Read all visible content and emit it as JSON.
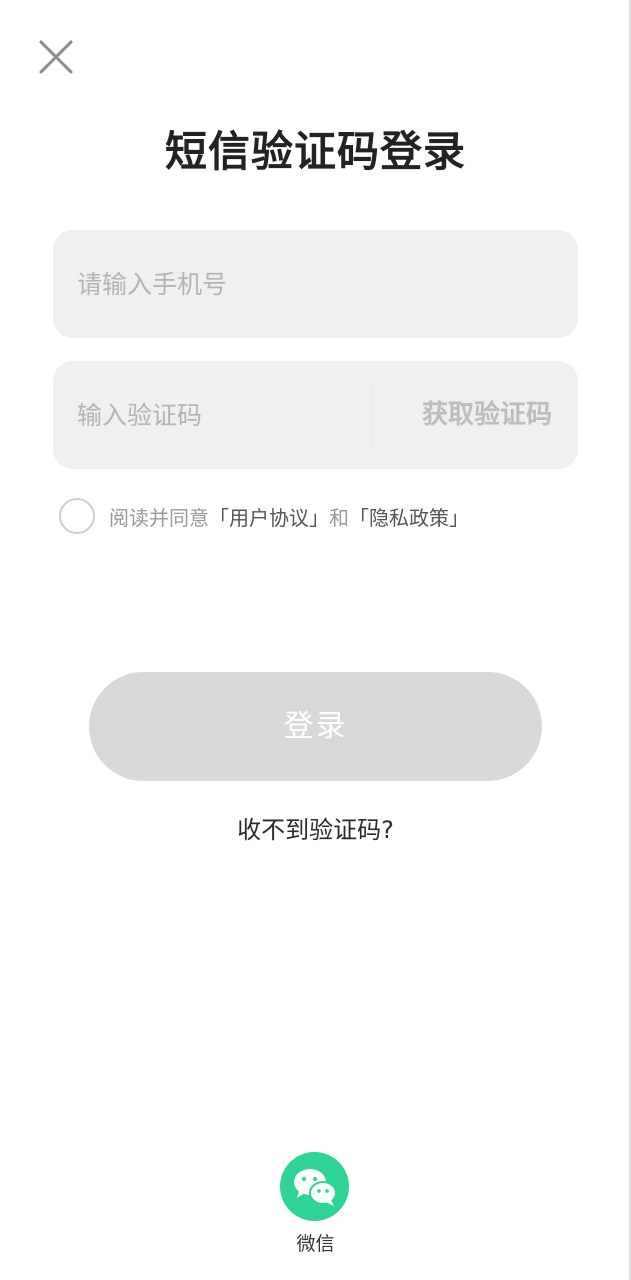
{
  "header": {
    "close_icon": "close-icon",
    "title": "短信验证码登录"
  },
  "form": {
    "phone_placeholder": "请输入手机号",
    "phone_value": "",
    "code_placeholder": "输入验证码",
    "code_value": "",
    "get_code_label": "获取验证码"
  },
  "agreement": {
    "checked": false,
    "prefix": "阅读并同意",
    "user_agreement": "「用户协议」",
    "connector": "和",
    "privacy_policy": "「隐私政策」"
  },
  "actions": {
    "login_label": "登录",
    "no_code_label": "收不到验证码?"
  },
  "third_party": {
    "wechat_icon": "wechat-icon",
    "wechat_label": "微信"
  },
  "colors": {
    "title": "#222222",
    "field_bg": "#f0f0f0",
    "placeholder": "#b4b4b4",
    "login_disabled_bg": "#d9d9d9",
    "wechat_green": "#2ed396"
  }
}
